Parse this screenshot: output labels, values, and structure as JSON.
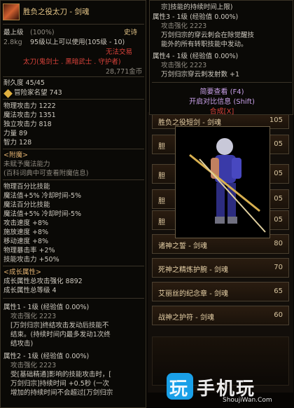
{
  "left": {
    "title": "胜负之役太刀 - 剑魂",
    "level_label": "最上级",
    "level_pct": "(100%)",
    "rarity": "史诗",
    "weight": "2.8kg",
    "usable": "95级以上可以使用(105级 - 10)",
    "no_trade": "无法交易",
    "class_line": "太刀(鬼剑士 . 黑暗武士 . 守护者)",
    "gold": "28,771金币",
    "durability": "耐久度 45/45",
    "reputation": "冒险家名望 743",
    "stats": [
      "物理攻击力 1222",
      "魔法攻击力 1351",
      "独立攻击力 818",
      "力量 89",
      "智力 128"
    ],
    "enchant_header": "<附魔>",
    "enchant_none": "未赋予魔法能力",
    "enchant_hint": "(百科词典中可查看附魔信息)",
    "pct_lines": [
      "物理百分比技能",
      "  魔法值+5% 冷却时间-5%",
      "魔法百分比技能",
      "  魔法值+5% 冷却时间-5%",
      "攻击速度 +8%",
      "施放速度 +8%",
      "移动速度 +8%",
      "物理暴击率 +2%",
      "技能攻击力 +50%"
    ],
    "growth_header": "<成长属性>",
    "growth_total": "成长属性总攻击强化 8892",
    "growth_pts": "成长属性总等级 4",
    "attr1": "属性1 - 1级 (经验值 0.00%)",
    "attr1_str": "  攻击强化 2223",
    "attr1_desc": [
      "[万剑归宗]终结攻击发动后技能不",
      "结束。(持续时间内最多发动1次终",
      "结攻击)"
    ],
    "attr2": "属性2 - 1级 (经验值 0.00%)",
    "attr2_str": "  攻击强化 2223",
    "attr2_desc": [
      "受[基础精通]影响的技能攻击时，[",
      "万剑归宗]持续时间 +0.5秒 (一次",
      "增加的持续时间不会超过[万剑归宗"
    ]
  },
  "right": {
    "top_line": "宗]技能的持续时间上限)",
    "attr3": "属性3 - 1级 (经验值 0.00%)",
    "attr3_str": "攻击强化 2223",
    "attr3_desc": [
      "万剑归宗的穿云刺会在除觉醒技",
      "能外的所有转职技能中发动。"
    ],
    "attr4": "属性4 - 1级 (经验值 0.00%)",
    "attr4_str": "攻击强化 2223",
    "attr4_desc": "万剑归宗穿云刺发射数 +1",
    "btn_simple": "简要查看 (F4)",
    "btn_compare": "开启对比信息 (Shift)",
    "btn_combine": "合成[X]"
  },
  "list": [
    {
      "name": "胜负之役短剑 - 剑魂",
      "lv": "105"
    },
    {
      "name": "胆",
      "lv": "05"
    },
    {
      "name": "胆",
      "lv": "05"
    },
    {
      "name": "胆",
      "lv": "05"
    },
    {
      "name": "胆",
      "lv": "05"
    },
    {
      "name": "诸神之誓 - 剑魂",
      "lv": "80"
    },
    {
      "name": "死神之精炼护腕 - 剑魂",
      "lv": "70"
    },
    {
      "name": "艾丽丝的纪念章 - 剑魂",
      "lv": "65"
    },
    {
      "name": "战神之护符 - 剑魂",
      "lv": "60"
    }
  ],
  "watermark": {
    "main": "玩 手机玩",
    "sub": "ShoujiWan.Com"
  }
}
